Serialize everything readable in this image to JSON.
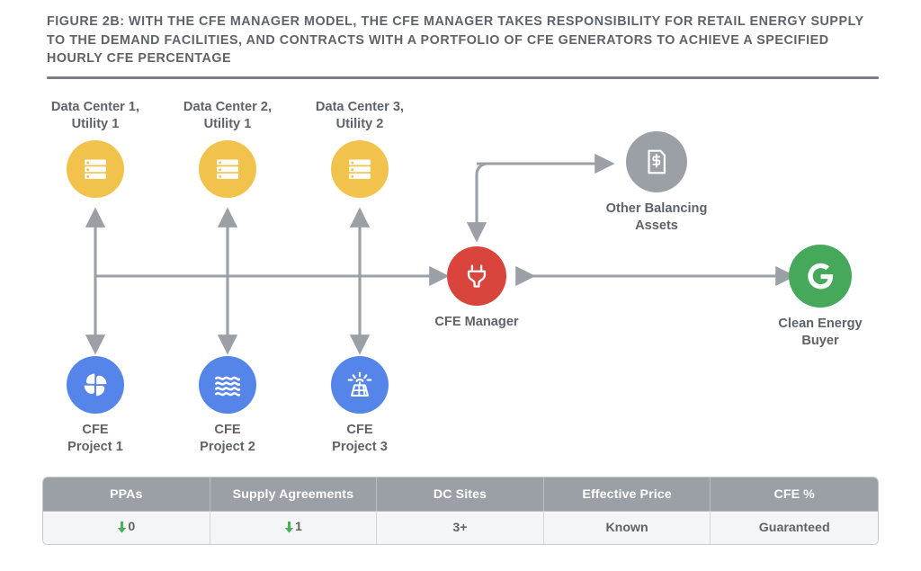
{
  "figure": {
    "title": "FIGURE 2B: WITH THE CFE MANAGER MODEL, THE CFE MANAGER TAKES RESPONSIBILITY FOR RETAIL ENERGY SUPPLY TO THE DEMAND FACILITIES, AND CONTRACTS WITH A PORTFOLIO OF CFE GENERATORS TO ACHIEVE A SPECIFIED HOURLY CFE PERCENTAGE"
  },
  "colors": {
    "data_center": "#F1C24C",
    "cfe_project": "#5585E8",
    "cfe_manager": "#D9453C",
    "balancing_assets": "#9AA0A6",
    "clean_energy_buyer": "#45A85A",
    "connector": "#9AA0A6",
    "text": "#5F6368",
    "table_header": "#9AA0A6",
    "table_row": "#F4F5F6",
    "green_arrow": "#46B05A"
  },
  "nodes": {
    "data_centers": [
      {
        "id": "data-center-1",
        "label": "Data Center 1,\nUtility 1",
        "icon": "server-rack-icon"
      },
      {
        "id": "data-center-2",
        "label": "Data Center 2,\nUtility 1",
        "icon": "server-rack-icon"
      },
      {
        "id": "data-center-3",
        "label": "Data Center 3,\nUtility 2",
        "icon": "server-rack-icon"
      }
    ],
    "cfe_projects": [
      {
        "id": "cfe-project-1",
        "label": "CFE\nProject 1",
        "icon": "wind-turbine-icon"
      },
      {
        "id": "cfe-project-2",
        "label": "CFE\nProject 2",
        "icon": "water-waves-icon"
      },
      {
        "id": "cfe-project-3",
        "label": "CFE\nProject 3",
        "icon": "solar-panel-icon"
      }
    ],
    "cfe_manager": {
      "id": "cfe-manager",
      "label": "CFE Manager",
      "icon": "power-plug-icon"
    },
    "balancing_assets": {
      "id": "other-balancing-assets",
      "label": "Other Balancing\nAssets",
      "icon": "invoice-dollar-icon"
    },
    "clean_energy_buyer": {
      "id": "clean-energy-buyer",
      "label": "Clean Energy\nBuyer",
      "icon": "google-g-icon"
    }
  },
  "table": {
    "headers": [
      "PPAs",
      "Supply Agreements",
      "DC Sites",
      "Effective Price",
      "CFE %"
    ],
    "rows": [
      [
        {
          "text": "0",
          "arrow": "down"
        },
        {
          "text": "1",
          "arrow": "down"
        },
        {
          "text": "3+",
          "arrow": "none"
        },
        {
          "text": "Known",
          "arrow": "none"
        },
        {
          "text": "Guaranteed",
          "arrow": "none"
        }
      ]
    ]
  }
}
